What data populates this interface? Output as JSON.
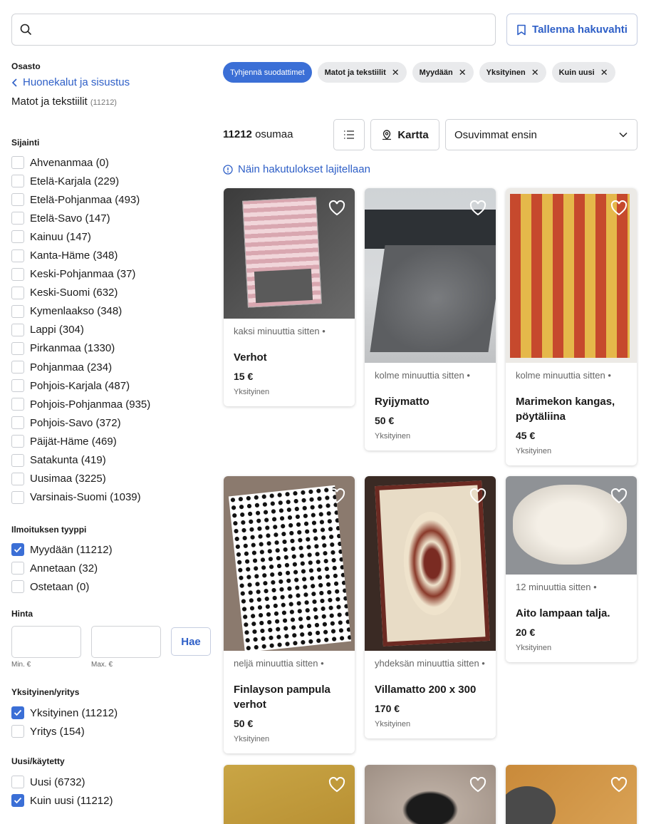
{
  "search": {
    "placeholder": ""
  },
  "save_search_label": "Tallenna hakuvahti",
  "sidebar": {
    "section_label": "Osasto",
    "back_label": "Huonekalut ja sisustus",
    "current_category": "Matot ja tekstiilit",
    "current_count": "(11212)",
    "location_title": "Sijainti",
    "locations": [
      {
        "label": "Ahvenanmaa (0)",
        "checked": false
      },
      {
        "label": "Etelä-Karjala (229)",
        "checked": false
      },
      {
        "label": "Etelä-Pohjanmaa (493)",
        "checked": false
      },
      {
        "label": "Etelä-Savo (147)",
        "checked": false
      },
      {
        "label": "Kainuu (147)",
        "checked": false
      },
      {
        "label": "Kanta-Häme (348)",
        "checked": false
      },
      {
        "label": "Keski-Pohjanmaa (37)",
        "checked": false
      },
      {
        "label": "Keski-Suomi (632)",
        "checked": false
      },
      {
        "label": "Kymenlaakso (348)",
        "checked": false
      },
      {
        "label": "Lappi (304)",
        "checked": false
      },
      {
        "label": "Pirkanmaa (1330)",
        "checked": false
      },
      {
        "label": "Pohjanmaa (234)",
        "checked": false
      },
      {
        "label": "Pohjois-Karjala (487)",
        "checked": false
      },
      {
        "label": "Pohjois-Pohjanmaa (935)",
        "checked": false
      },
      {
        "label": "Pohjois-Savo (372)",
        "checked": false
      },
      {
        "label": "Päijät-Häme (469)",
        "checked": false
      },
      {
        "label": "Satakunta (419)",
        "checked": false
      },
      {
        "label": "Uusimaa (3225)",
        "checked": false
      },
      {
        "label": "Varsinais-Suomi (1039)",
        "checked": false
      }
    ],
    "type_title": "Ilmoituksen tyyppi",
    "types": [
      {
        "label": "Myydään (11212)",
        "checked": true
      },
      {
        "label": "Annetaan (32)",
        "checked": false
      },
      {
        "label": "Ostetaan (0)",
        "checked": false
      }
    ],
    "price_title": "Hinta",
    "price_min_label": "Min. €",
    "price_max_label": "Max. €",
    "price_submit": "Hae",
    "seller_title": "Yksityinen/yritys",
    "sellers": [
      {
        "label": "Yksityinen (11212)",
        "checked": true
      },
      {
        "label": "Yritys (154)",
        "checked": false
      }
    ],
    "condition_title": "Uusi/käytetty",
    "conditions": [
      {
        "label": "Uusi (6732)",
        "checked": false
      },
      {
        "label": "Kuin uusi (11212)",
        "checked": true
      }
    ]
  },
  "filters": {
    "clear_label": "Tyhjennä suodattimet",
    "active": [
      "Matot ja tekstiilit",
      "Myydään",
      "Yksityinen",
      "Kuin uusi"
    ]
  },
  "results": {
    "count": "11212",
    "count_suffix": "osumaa",
    "map_label": "Kartta",
    "sort_value": "Osuvimmat ensin",
    "info_link": "Näin hakutulokset lajitellaan"
  },
  "listings": [
    {
      "time": "kaksi minuuttia sitten •",
      "title": "Verhot",
      "price": "15 €",
      "seller": "Yksityinen"
    },
    {
      "time": "kolme minuuttia sitten •",
      "title": "Ryijymatto",
      "price": "50 €",
      "seller": "Yksityinen"
    },
    {
      "time": "kolme minuuttia sitten •",
      "title": "Marimekon kangas, pöytäliina",
      "price": "45 €",
      "seller": "Yksityinen"
    },
    {
      "time": "neljä minuuttia sitten •",
      "title": "Finlayson pampula verhot",
      "price": "50 €",
      "seller": "Yksityinen"
    },
    {
      "time": "yhdeksän minuuttia sitten •",
      "title": "Villamatto 200 x 300",
      "price": "170 €",
      "seller": "Yksityinen"
    },
    {
      "time": "12 minuuttia sitten •",
      "title": "Aito lampaan talja.",
      "price": "20 €",
      "seller": "Yksityinen"
    }
  ],
  "icons": {
    "search": "search-icon",
    "bookmark": "bookmark-icon",
    "back": "chevron-left-icon",
    "close": "close-icon",
    "list": "list-icon",
    "map": "map-pin-icon",
    "sort": "chevron-down-icon",
    "info": "info-icon",
    "heart": "heart-icon",
    "check": "check-icon"
  },
  "colors": {
    "accent": "#2e5fc7",
    "checkbox": "#3b6fd6",
    "chip_bg": "#e9eaec"
  }
}
